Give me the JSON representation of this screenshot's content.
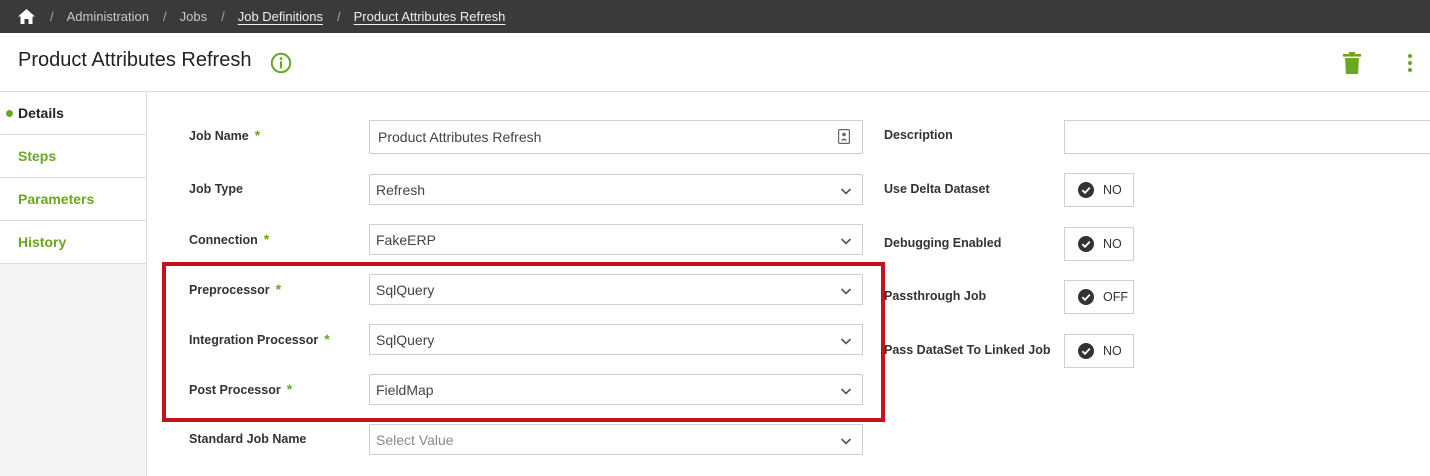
{
  "breadcrumb": {
    "items": [
      "Administration",
      "Jobs",
      "Job Definitions",
      "Product Attributes Refresh"
    ],
    "separator": "/"
  },
  "header": {
    "title": "Product Attributes Refresh"
  },
  "sidebar": {
    "items": [
      {
        "label": "Details",
        "active": true
      },
      {
        "label": "Steps",
        "active": false
      },
      {
        "label": "Parameters",
        "active": false
      },
      {
        "label": "History",
        "active": false
      }
    ]
  },
  "form": {
    "job_name": {
      "label": "Job Name",
      "required_mark": "*",
      "value": "Product Attributes Refresh"
    },
    "job_type": {
      "label": "Job Type",
      "value": "Refresh"
    },
    "connection": {
      "label": "Connection",
      "required_mark": "*",
      "value": "FakeERP"
    },
    "preprocessor": {
      "label": "Preprocessor",
      "required_mark": "*",
      "value": "SqlQuery"
    },
    "integration_processor": {
      "label": "Integration Processor",
      "required_mark": "*",
      "value": "SqlQuery"
    },
    "post_processor": {
      "label": "Post Processor",
      "required_mark": "*",
      "value": "FieldMap"
    },
    "standard_job_name": {
      "label": "Standard Job Name",
      "placeholder": "Select Value"
    },
    "description": {
      "label": "Description",
      "value": ""
    },
    "use_delta_dataset": {
      "label": "Use Delta Dataset",
      "value": "NO"
    },
    "debugging_enabled": {
      "label": "Debugging Enabled",
      "value": "NO"
    },
    "passthrough_job": {
      "label": "Passthrough Job",
      "value": "OFF"
    },
    "pass_dataset": {
      "label": "Pass DataSet To Linked Job",
      "value": "NO"
    }
  },
  "colors": {
    "accent": "#6aa621",
    "highlight": "#c4141b",
    "topbar": "#3a3a3a"
  }
}
